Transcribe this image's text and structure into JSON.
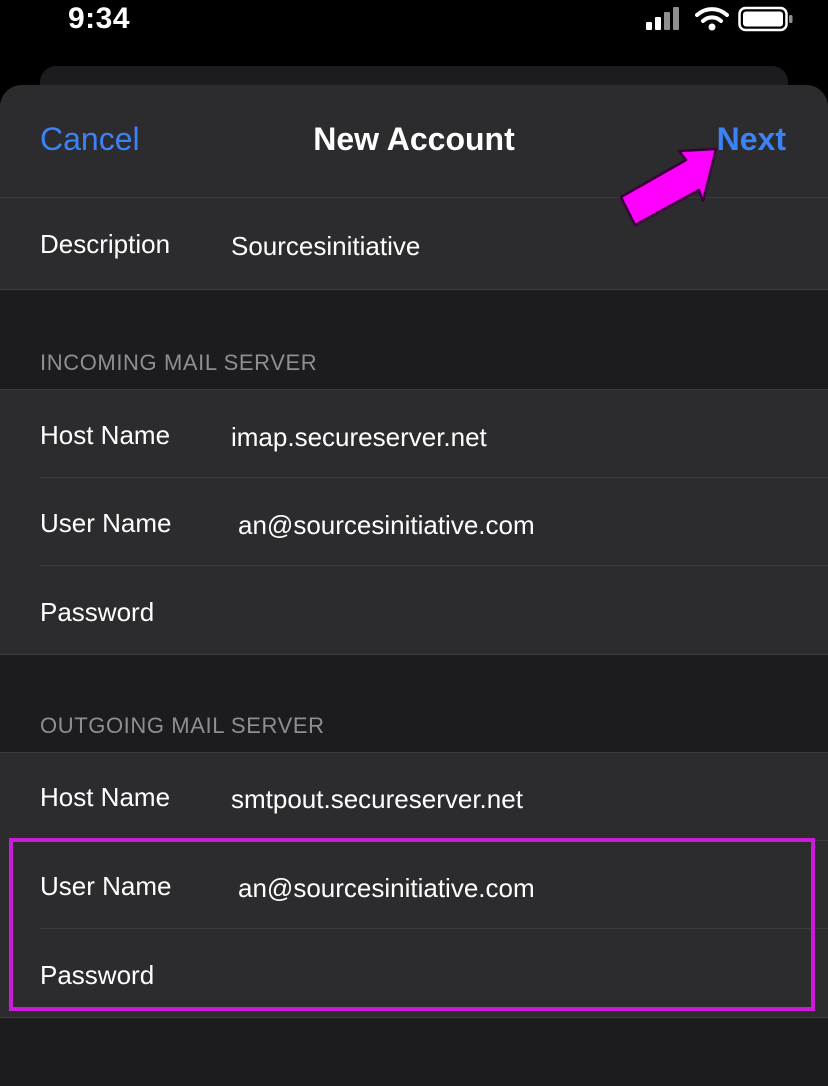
{
  "status_bar": {
    "time": "9:34",
    "icons": [
      "cellular-signal-icon",
      "wifi-icon",
      "battery-icon"
    ]
  },
  "nav": {
    "cancel_label": "Cancel",
    "title": "New Account",
    "next_label": "Next"
  },
  "description": {
    "label": "Description",
    "value": "Sourcesinitiative"
  },
  "incoming": {
    "header": "INCOMING MAIL SERVER",
    "host_label": "Host Name",
    "host_value": "imap.secureserver.net",
    "user_label": "User Name",
    "user_value": "an@sourcesinitiative.com",
    "password_label": "Password",
    "password_value": ""
  },
  "outgoing": {
    "header": "OUTGOING MAIL SERVER",
    "host_label": "Host Name",
    "host_value": "smtpout.secureserver.net",
    "user_label": "User Name",
    "user_value": "an@sourcesinitiative.com",
    "password_label": "Password",
    "password_value": ""
  },
  "colors": {
    "accent": "#3b82f6",
    "annotation": "#c81cd6",
    "arrow": "#ff00ff"
  }
}
